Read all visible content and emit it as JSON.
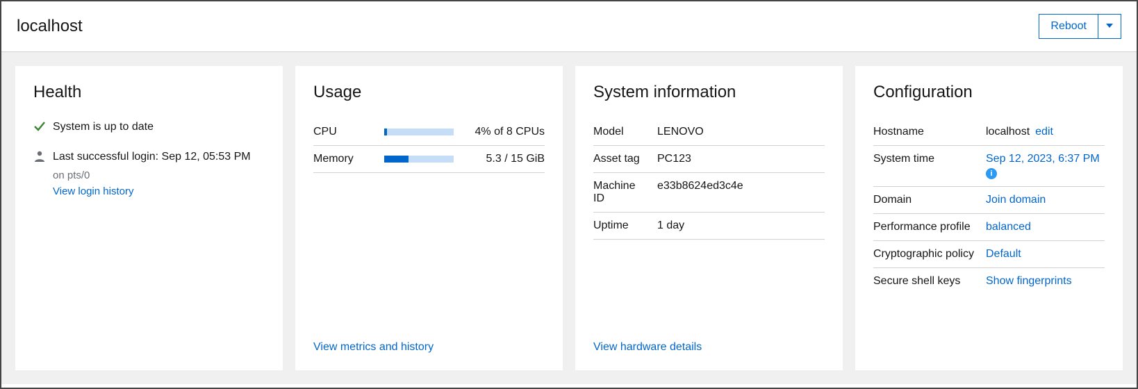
{
  "header": {
    "title": "localhost",
    "reboot_label": "Reboot"
  },
  "health": {
    "title": "Health",
    "uptodate": "System is up to date",
    "last_login": "Last successful login: Sep 12, 05:53 PM",
    "last_login_sub": "on pts/0",
    "view_login_history": "View login history"
  },
  "usage": {
    "title": "Usage",
    "cpu_label": "CPU",
    "cpu_value": "4% of 8 CPUs",
    "cpu_pct": 4,
    "mem_label": "Memory",
    "mem_value": "5.3 / 15 GiB",
    "mem_pct": 35,
    "view_metrics": "View metrics and history"
  },
  "sysinfo": {
    "title": "System information",
    "model_label": "Model",
    "model_value": "LENOVO",
    "asset_label": "Asset tag",
    "asset_value": "PC123",
    "machine_label": "Machine ID",
    "machine_value": "e33b8624ed3c4e",
    "uptime_label": "Uptime",
    "uptime_value": "1 day",
    "view_hardware": "View hardware details"
  },
  "config": {
    "title": "Configuration",
    "hostname_label": "Hostname",
    "hostname_value": "localhost",
    "hostname_edit": "edit",
    "systime_label": "System time",
    "systime_value": "Sep 12, 2023, 6:37 PM",
    "domain_label": "Domain",
    "domain_value": "Join domain",
    "perf_label": "Performance profile",
    "perf_value": "balanced",
    "crypto_label": "Cryptographic policy",
    "crypto_value": "Default",
    "ssh_label": "Secure shell keys",
    "ssh_value": "Show fingerprints"
  }
}
